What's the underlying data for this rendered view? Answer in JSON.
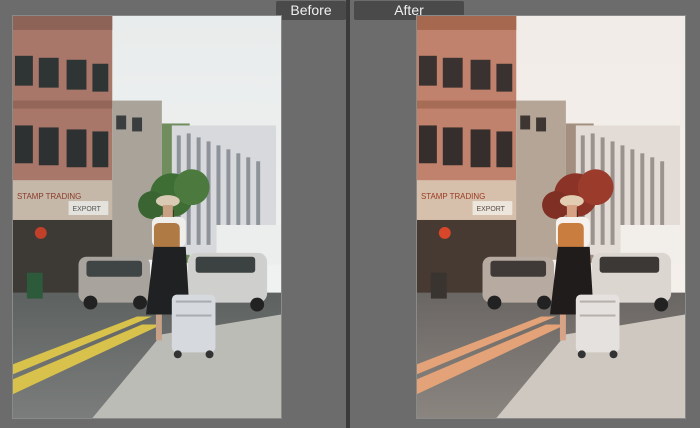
{
  "labels": {
    "before": "Before",
    "after": "After"
  },
  "colors": {
    "background": "#6c6c6c",
    "divider": "#3a3a3a",
    "label_bg": "#4a4a4a",
    "label_text": "#f0f0f0"
  },
  "photos": {
    "before": {
      "tone": "neutral-cool"
    },
    "after": {
      "tone": "warm"
    }
  },
  "signage": {
    "shop_sign": "STAMP TRADING",
    "building_sign": "EXPORT"
  }
}
